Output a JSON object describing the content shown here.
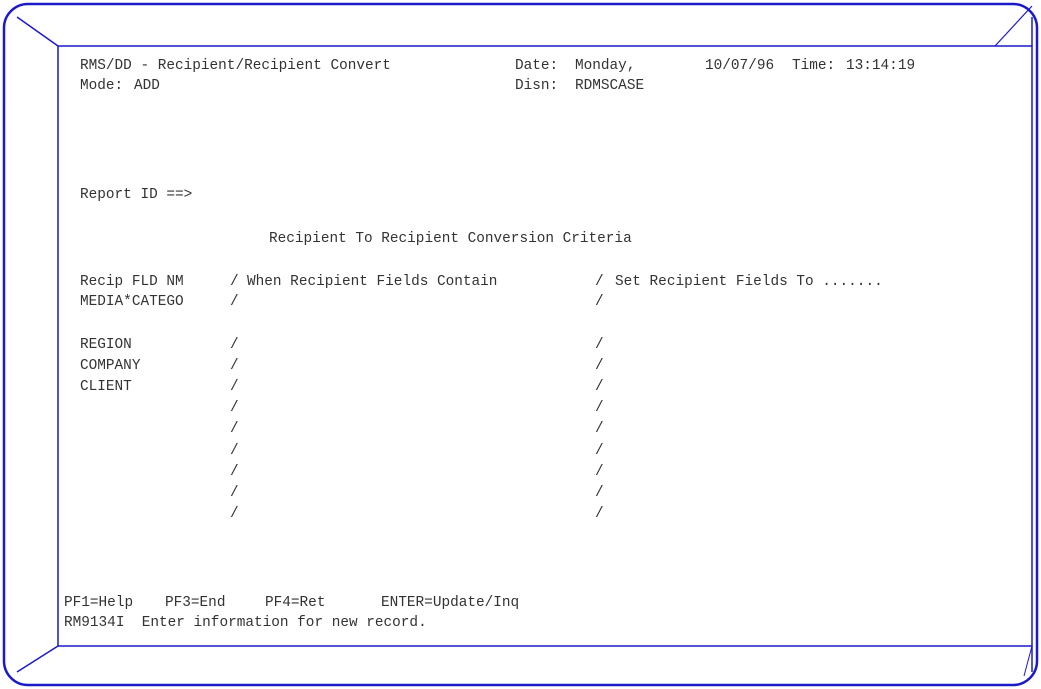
{
  "colors": {
    "frame_border": "#1a1ac8",
    "text": "#333333",
    "background": "#ffffff"
  },
  "header": {
    "title": "RMS/DD - Recipient/Recipient Convert",
    "date_label": "Date:",
    "date_day": "Monday,",
    "date_value": "10/07/96",
    "time_label": "Time:",
    "time_value": "13:14:19",
    "mode_label": "Mode:",
    "mode_value": "ADD",
    "disn_label": "Disn:",
    "disn_value": "RDMSCASE"
  },
  "report": {
    "label": "Report ID ==>",
    "value": ""
  },
  "section_title": "Recipient To Recipient Conversion Criteria",
  "table": {
    "col_field": "Recip FLD NM",
    "col_sep1": "/",
    "col_when": "When Recipient Fields Contain",
    "col_sep2": "/",
    "col_set": "Set Recipient Fields To .......",
    "rows": [
      {
        "field": "MEDIA*CATEGO",
        "sep1": "/",
        "when": "",
        "sep2": "/",
        "set": ""
      },
      {
        "field": "REGION",
        "sep1": "/",
        "when": "",
        "sep2": "/",
        "set": ""
      },
      {
        "field": "COMPANY",
        "sep1": "/",
        "when": "",
        "sep2": "/",
        "set": ""
      },
      {
        "field": "CLIENT",
        "sep1": "/",
        "when": "",
        "sep2": "/",
        "set": ""
      },
      {
        "field": "",
        "sep1": "/",
        "when": "",
        "sep2": "/",
        "set": ""
      },
      {
        "field": "",
        "sep1": "/",
        "when": "",
        "sep2": "/",
        "set": ""
      },
      {
        "field": "",
        "sep1": "/",
        "when": "",
        "sep2": "/",
        "set": ""
      },
      {
        "field": "",
        "sep1": "/",
        "when": "",
        "sep2": "/",
        "set": ""
      },
      {
        "field": "",
        "sep1": "/",
        "when": "",
        "sep2": "/",
        "set": ""
      },
      {
        "field": "",
        "sep1": "/",
        "when": "",
        "sep2": "/",
        "set": ""
      }
    ]
  },
  "footer": {
    "pf1": "PF1=Help",
    "pf3": "PF3=End",
    "pf4": "PF4=Ret",
    "enter": "ENTER=Update/Inq",
    "message": "RM9134I  Enter information for new record."
  }
}
